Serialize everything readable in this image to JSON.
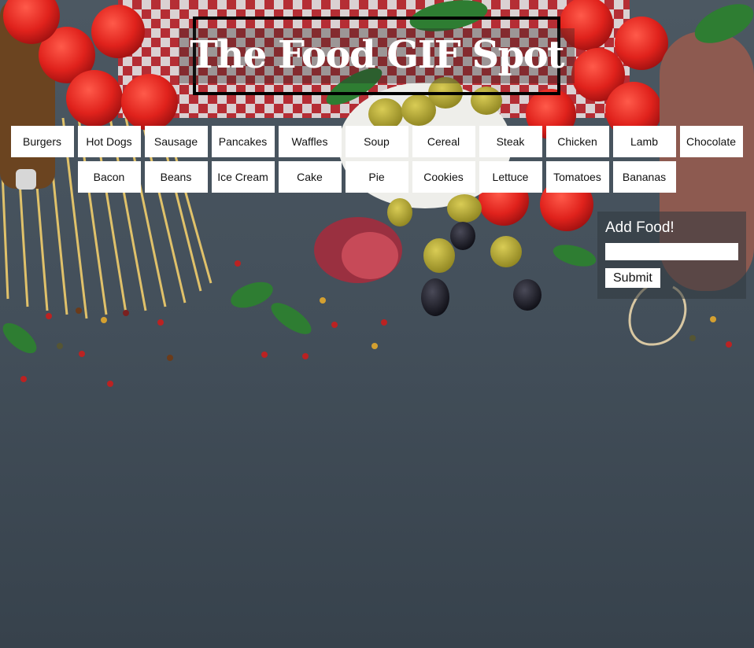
{
  "header": {
    "title": "The Food GIF Spot"
  },
  "categories": {
    "row1": [
      "Burgers",
      "Hot Dogs",
      "Sausage",
      "Pancakes",
      "Waffles",
      "Soup",
      "Cereal",
      "Steak",
      "Chicken",
      "Lamb",
      "Chocolate"
    ],
    "row2": [
      "Bacon",
      "Beans",
      "Ice Cream",
      "Cake",
      "Pie",
      "Cookies",
      "Lettuce",
      "Tomatoes",
      "Bananas"
    ]
  },
  "add_form": {
    "title": "Add Food!",
    "input_value": "",
    "input_placeholder": "",
    "submit_label": "Submit"
  },
  "colors": {
    "button_bg": "#ffffff",
    "title_text": "#ffffff",
    "slate_background": "#3e4a55"
  }
}
